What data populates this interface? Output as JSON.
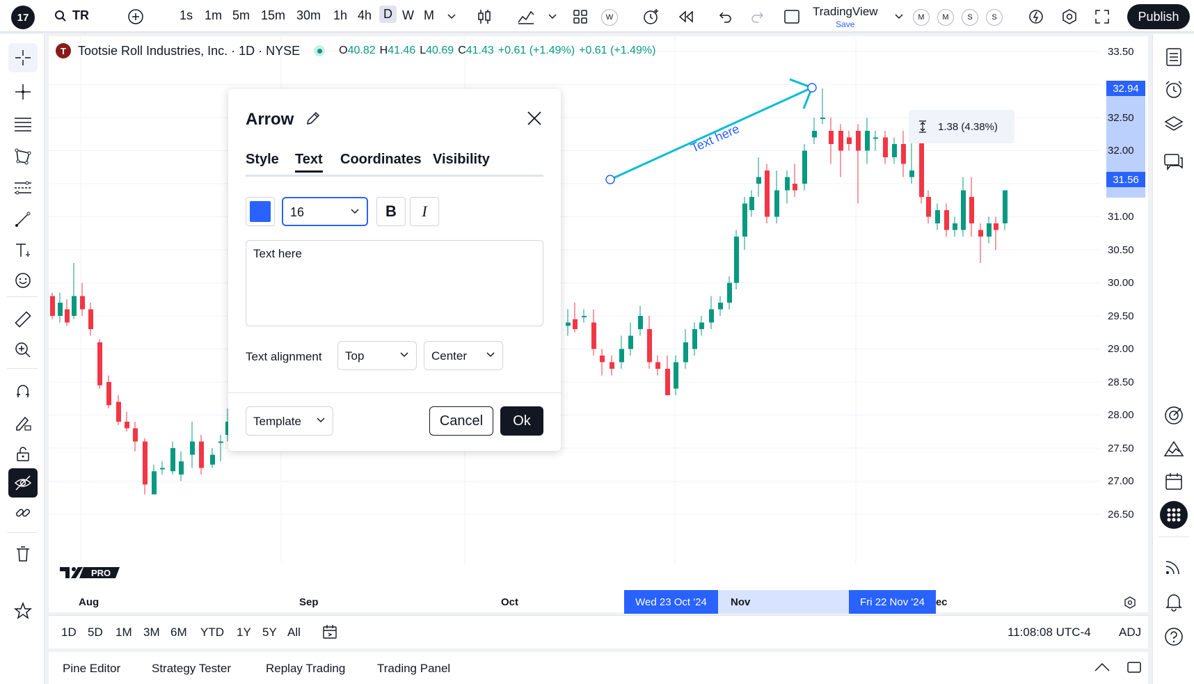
{
  "toolbar": {
    "symbol": "TR",
    "intervals": [
      "1s",
      "1m",
      "5m",
      "15m",
      "30m",
      "1h",
      "4h",
      "D",
      "W",
      "M"
    ],
    "active_interval": "D",
    "layout_name": "TradingView",
    "layout_save": "Save",
    "mini_badges": [
      "M",
      "M",
      "S",
      "S"
    ],
    "timeframe_badge": "W",
    "publish_label": "Publish"
  },
  "chart": {
    "company": "Tootsie Roll Industries, Inc. · 1D · NYSE",
    "logo_letter": "T",
    "ohlc": {
      "o_key": "O",
      "o_val": "40.82",
      "h_key": "H",
      "h_val": "41.46",
      "l_key": "L",
      "l_val": "40.69",
      "c_key": "C",
      "c_val": "41.43",
      "chg": "+0.61 (+1.49%)",
      "chg2": "+0.61 (+1.49%)"
    },
    "up_color": "#089981",
    "down_color": "#f23645",
    "price_labels": [
      "33.50",
      "32.50",
      "32.00",
      "31.00",
      "30.50",
      "30.00",
      "29.50",
      "29.00",
      "28.50",
      "28.00",
      "27.50",
      "27.00",
      "26.50"
    ],
    "price_tag_high": "32.94",
    "price_tag_low": "31.56",
    "time_labels": [
      "Aug",
      "Sep",
      "Oct",
      "Nov",
      "Dec"
    ],
    "time_tag_start": "Wed 23 Oct '24",
    "time_tag_end": "Fri 22 Nov '24",
    "measure_text": "1.38 (4.38%)",
    "arrow_text": "Text here",
    "arrow_color": "#00bcd4",
    "watermark": "PRO"
  },
  "range_bar": {
    "ranges": [
      "1D",
      "5D",
      "1M",
      "3M",
      "6M",
      "YTD",
      "1Y",
      "5Y",
      "All"
    ],
    "clock": "11:08:08 UTC-4",
    "adj": "ADJ"
  },
  "bottom_panel": {
    "tabs": [
      "Pine Editor",
      "Strategy Tester",
      "Replay Trading",
      "Trading Panel"
    ]
  },
  "dialog": {
    "title": "Arrow",
    "tabs": [
      "Style",
      "Text",
      "Coordinates",
      "Visibility"
    ],
    "active_tab": "Text",
    "color": "#2962ff",
    "font_size": "16",
    "bold_label": "B",
    "italic_label": "I",
    "text_value": "Text here",
    "alignment_label": "Text alignment",
    "valign": "Top",
    "halign": "Center",
    "template_label": "Template",
    "cancel_label": "Cancel",
    "ok_label": "Ok"
  }
}
